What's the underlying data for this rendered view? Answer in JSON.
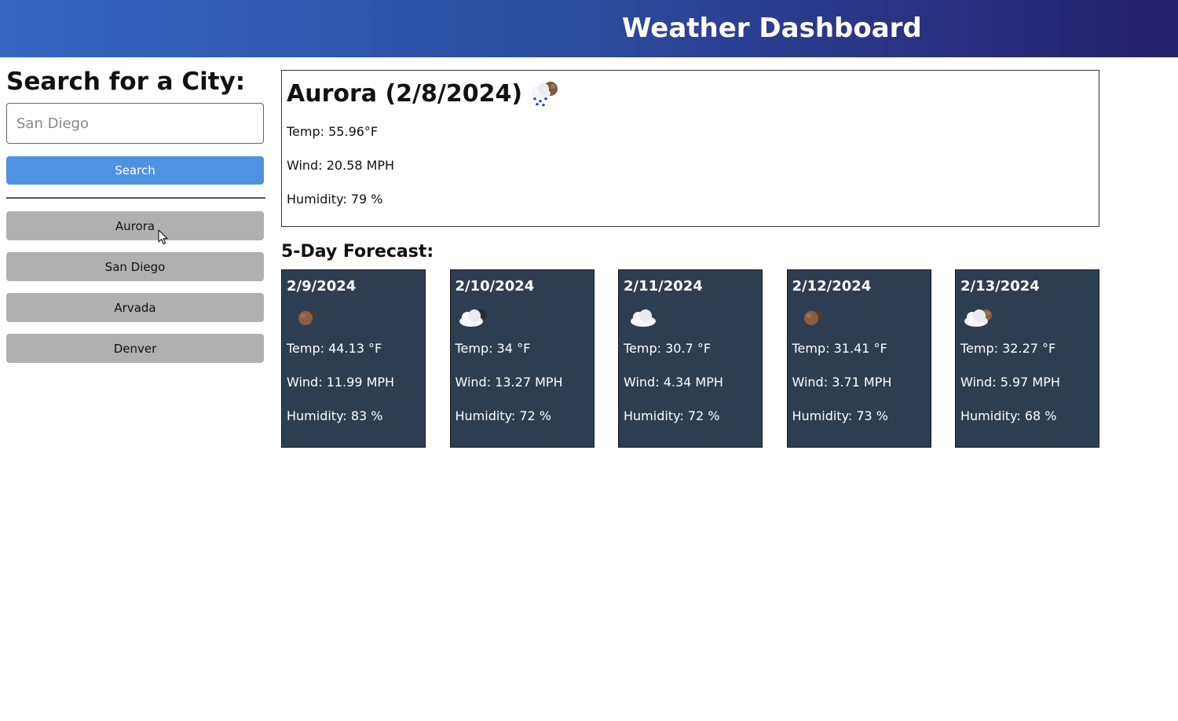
{
  "header": {
    "title": "Weather Dashboard"
  },
  "sidebar": {
    "heading": "Search for a City:",
    "search_placeholder": "San Diego",
    "search_label": "Search",
    "history": [
      "Aurora",
      "San Diego",
      "Arvada",
      "Denver"
    ]
  },
  "current": {
    "title": "Aurora (2/8/2024)",
    "icon": "rain-cloud-moon-icon",
    "temp": "Temp: 55.96°F",
    "wind": "Wind: 20.58 MPH",
    "humidity": "Humidity: 79 %"
  },
  "forecast": {
    "title": "5-Day Forecast:",
    "days": [
      {
        "date": "2/9/2024",
        "icon": "moon-icon",
        "temp": "Temp: 44.13 °F",
        "wind": "Wind: 11.99 MPH",
        "humidity": "Humidity: 83 %"
      },
      {
        "date": "2/10/2024",
        "icon": "cloud-moon-icon",
        "temp": "Temp: 34 °F",
        "wind": "Wind: 13.27 MPH",
        "humidity": "Humidity: 72 %"
      },
      {
        "date": "2/11/2024",
        "icon": "cloud-icon",
        "temp": "Temp: 30.7 °F",
        "wind": "Wind: 4.34 MPH",
        "humidity": "Humidity: 72 %"
      },
      {
        "date": "2/12/2024",
        "icon": "moon-icon",
        "temp": "Temp: 31.41 °F",
        "wind": "Wind: 3.71 MPH",
        "humidity": "Humidity: 73 %"
      },
      {
        "date": "2/13/2024",
        "icon": "cloud-moon-icon",
        "temp": "Temp: 32.27 °F",
        "wind": "Wind: 5.97 MPH",
        "humidity": "Humidity: 68 %"
      }
    ]
  },
  "colors": {
    "header_start": "#3466c2",
    "header_end": "#261f6b",
    "search_button": "#4f92e3",
    "history_button": "#b0b0b0",
    "card_background": "#2e3e52"
  }
}
